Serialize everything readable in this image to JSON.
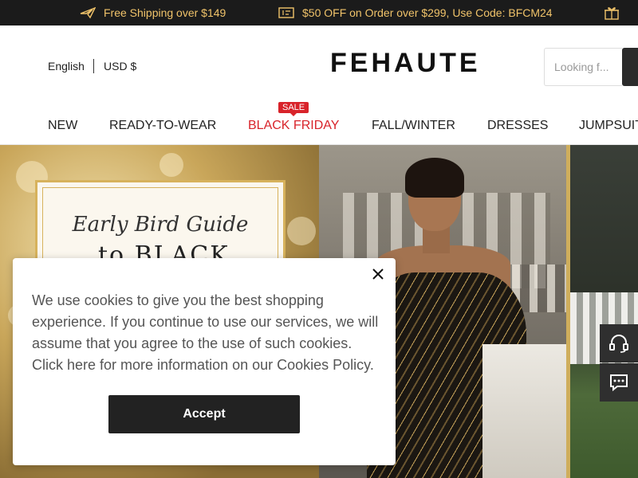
{
  "promo_bar": {
    "items": [
      {
        "icon": "plane-icon",
        "text": "Free Shipping over $149"
      },
      {
        "icon": "coupon-icon",
        "text": "$50 OFF on Order over $299, Use Code: BFCM24"
      },
      {
        "icon": "gift-icon",
        "text": ""
      }
    ],
    "color": "#f0c36a"
  },
  "header": {
    "language": "English",
    "currency": "USD $",
    "logo": "FEHAUTE",
    "search_placeholder": "Looking f..."
  },
  "nav": {
    "items": [
      {
        "label": "NEW"
      },
      {
        "label": "READY-TO-WEAR"
      },
      {
        "label": "BLACK FRIDAY",
        "badge": "SALE"
      },
      {
        "label": "FALL/WINTER"
      },
      {
        "label": "DRESSES"
      },
      {
        "label": "JUMPSUITS"
      }
    ],
    "sale_color": "#d8232a"
  },
  "hero": {
    "guide_title": "Early Bird Guide",
    "guide_sub": "to BLACK"
  },
  "side_buttons": [
    {
      "icon": "headset-icon"
    },
    {
      "icon": "chat-icon"
    }
  ],
  "cookie_banner": {
    "text": "We use cookies to give you the best shopping experience. If you continue to use our services, we will assume that you agree to the use of such cookies. Click here for more information on our Cookies Policy.",
    "accept_label": "Accept"
  }
}
